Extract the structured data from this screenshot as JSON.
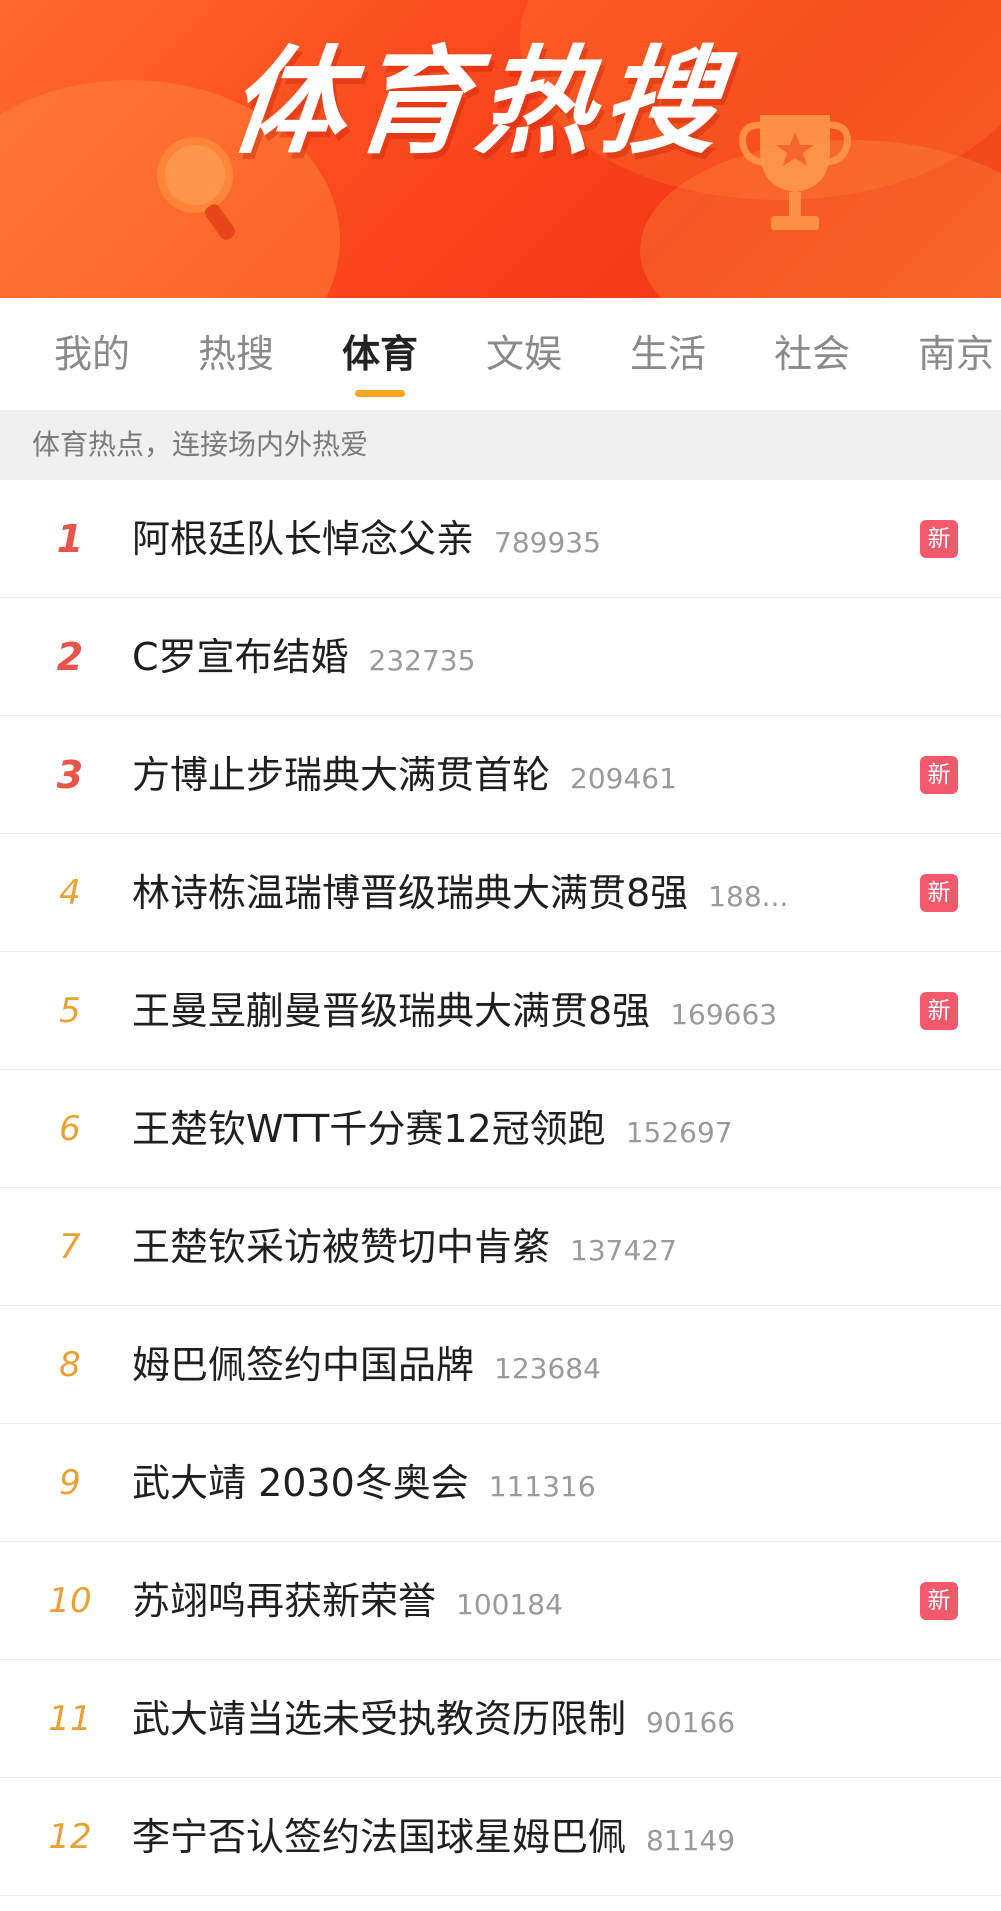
{
  "banner": {
    "title": "体育热搜",
    "icons": [
      "ping-pong-paddle-icon",
      "trophy-icon"
    ],
    "colors": {
      "primary": "#f43a17",
      "light": "#ff6a2b"
    }
  },
  "tabs": [
    {
      "label": "我的",
      "active": false
    },
    {
      "label": "热搜",
      "active": false
    },
    {
      "label": "体育",
      "active": true
    },
    {
      "label": "文娱",
      "active": false
    },
    {
      "label": "生活",
      "active": false
    },
    {
      "label": "社会",
      "active": false
    },
    {
      "label": "南京",
      "active": false
    }
  ],
  "subheader": {
    "text": "体育热点，连接场内外热爱"
  },
  "list": [
    {
      "rank": "1",
      "title": "阿根廷队长悼念父亲",
      "heat": "789935",
      "badge": "新"
    },
    {
      "rank": "2",
      "title": "C罗宣布结婚",
      "heat": "232735",
      "badge": ""
    },
    {
      "rank": "3",
      "title": "方博止步瑞典大满贯首轮",
      "heat": "209461",
      "badge": "新"
    },
    {
      "rank": "4",
      "title": "林诗栋温瑞博晋级瑞典大满贯8强",
      "heat": "188...",
      "badge": "新"
    },
    {
      "rank": "5",
      "title": "王曼昱蒯曼晋级瑞典大满贯8强",
      "heat": "169663",
      "badge": "新"
    },
    {
      "rank": "6",
      "title": "王楚钦WTT千分赛12冠领跑",
      "heat": "152697",
      "badge": ""
    },
    {
      "rank": "7",
      "title": "王楚钦采访被赞切中肯綮",
      "heat": "137427",
      "badge": ""
    },
    {
      "rank": "8",
      "title": "姆巴佩签约中国品牌",
      "heat": "123684",
      "badge": ""
    },
    {
      "rank": "9",
      "title": "武大靖 2030冬奥会",
      "heat": "111316",
      "badge": ""
    },
    {
      "rank": "10",
      "title": "苏翊鸣再获新荣誉",
      "heat": "100184",
      "badge": "新"
    },
    {
      "rank": "11",
      "title": "武大靖当选未受执教资历限制",
      "heat": "90166",
      "badge": ""
    },
    {
      "rank": "12",
      "title": "李宁否认签约法国球星姆巴佩",
      "heat": "81149",
      "badge": ""
    }
  ],
  "colors": {
    "rank_top": "#e8534a",
    "rank_other": "#e9a135",
    "badge_new": "#f25a6b",
    "tab_indicator": "#f5a623"
  }
}
